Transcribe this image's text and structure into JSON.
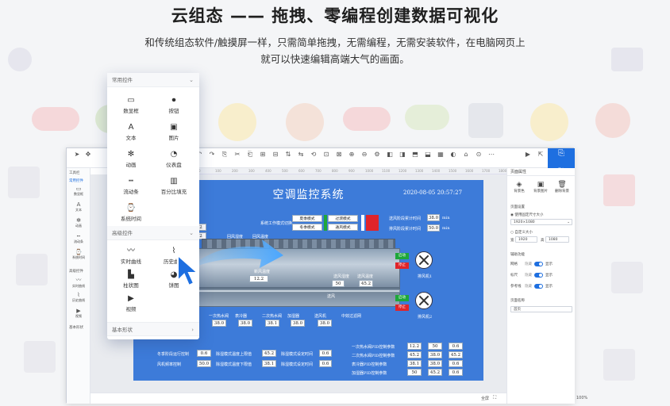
{
  "hero": {
    "title": "云组态 —— 拖拽、零编程创建数据可视化",
    "subtitle_line1": "和传统组态软件/触摸屏一样，只需简单拖拽，无需编程，无需安装软件，在电脑网页上",
    "subtitle_line2": "就可以快速编辑高端大气的画面。"
  },
  "component_panel": {
    "section_common": "常用控件",
    "common_items": [
      {
        "label": "数显框",
        "icon": "number-box-icon",
        "glyph": "▭"
      },
      {
        "label": "按钮",
        "icon": "button-icon",
        "glyph": "⏺"
      },
      {
        "label": "文本",
        "icon": "text-icon",
        "glyph": "A"
      },
      {
        "label": "图片",
        "icon": "image-icon",
        "glyph": "▣"
      },
      {
        "label": "动画",
        "icon": "animation-icon",
        "glyph": "✻"
      },
      {
        "label": "仪表盘",
        "icon": "gauge-icon",
        "glyph": "◔"
      },
      {
        "label": "流动条",
        "icon": "flow-bar-icon",
        "glyph": "┅"
      },
      {
        "label": "百分比填充",
        "icon": "percent-fill-icon",
        "glyph": "▥"
      },
      {
        "label": "系统时间",
        "icon": "clock-icon",
        "glyph": "⌚"
      }
    ],
    "section_advanced": "高级控件",
    "advanced_items": [
      {
        "label": "实时曲线",
        "icon": "realtime-curve-icon",
        "glyph": "〰"
      },
      {
        "label": "历史曲线",
        "icon": "history-curve-icon",
        "glyph": "⌇"
      },
      {
        "label": "柱状图",
        "icon": "bar-chart-icon",
        "glyph": "▙"
      },
      {
        "label": "饼图",
        "icon": "pie-chart-icon",
        "glyph": "◕"
      },
      {
        "label": "视频",
        "icon": "video-icon",
        "glyph": "▶"
      }
    ],
    "section_basic": "基本形状"
  },
  "editor": {
    "left_bar": {
      "head1": "工具栏",
      "head2": "常用控件",
      "items": [
        "数显框",
        "文本",
        "动画",
        "流动条",
        "系统时间"
      ],
      "head3": "高级控件",
      "items2": [
        "实时曲线",
        "历史曲线",
        "视频"
      ],
      "head4": "基本形状"
    },
    "ruler_ticks": [
      "0",
      "100",
      "200",
      "300",
      "400",
      "500",
      "600",
      "700",
      "800",
      "900",
      "1000",
      "1100",
      "1200",
      "1300",
      "1400",
      "1500",
      "1600",
      "1700",
      "1800"
    ],
    "status": {
      "fullscreen": "全屏",
      "zoom": "100%"
    },
    "save_label": "保存",
    "right_panel": {
      "tab": "页面属性",
      "icons": [
        {
          "label": "背景色",
          "glyph": "◈"
        },
        {
          "label": "背景图片",
          "glyph": "▣"
        },
        {
          "label": "删除背景",
          "glyph": "🗑"
        }
      ],
      "page_settings": "页面设置",
      "fixed_size": "使用固定尺寸大小",
      "size_value": "1920×1080",
      "custom_size": "自定义大小",
      "width_label": "宽",
      "width_value": "1920",
      "height_label": "高",
      "height_value": "1080",
      "assist": "辅助功能",
      "opt1": "网格",
      "opt1_state": "隐藏",
      "opt1_on": "显示",
      "opt2": "标尺",
      "opt3": "参考线",
      "page_name_label": "页面名称",
      "page_name_value": "首页"
    }
  },
  "scada": {
    "title": "空调监控系统",
    "datetime": "2020-08-05 20:57:27",
    "mode_label": "系统工作模式切换",
    "modes": [
      "夏季模式",
      "冬季模式",
      "过渡模式",
      "通风模式"
    ],
    "fan1_time_label": "送风阶段累计时间",
    "fan1_time": "38.0",
    "fan2_time_label": "排风阶段累计时间",
    "fan2_time": "50.0",
    "unit_min": "min",
    "return_hum_label": "回风湿度",
    "return_temp_label": "回风温度",
    "fresh_temp_label": "新风温度",
    "fresh_temp": "12.2",
    "supply_hum_label": "送风湿度",
    "supply_hum": "50",
    "supply_temp_label": "送风温度",
    "supply_temp": "45.2",
    "supply_fan_label": "送风",
    "left_val1": "2",
    "left_val2": "2",
    "start": "启动",
    "stop": "停止",
    "fan1": "排风机1",
    "fan2": "排风机2",
    "row_labels": [
      "一次热水阀",
      "表冷器",
      "二次热水阀",
      "加湿器",
      "送风机",
      "中效过滤网"
    ],
    "row_values": [
      "38.0",
      "38.0",
      "38.1",
      "38.0",
      "38.0"
    ],
    "bottom_left": [
      {
        "label": "冬季阶段运行控制",
        "value": "0.6"
      },
      {
        "label": "风机频率控制",
        "value": "50.0"
      }
    ],
    "bottom_mid": [
      {
        "label": "除湿模式温度上限值",
        "value": "45.2"
      },
      {
        "label": "除湿模式温度下限值",
        "value": "38.1"
      }
    ],
    "bottom_mid2": [
      {
        "label": "除湿模式设定时间",
        "value": "0.6"
      },
      {
        "label": "除湿模式设定时间",
        "value": "0.6"
      }
    ],
    "pid_rows": [
      {
        "label": "一次热水阀PID控制参数",
        "vals": [
          "12.2",
          "50",
          "0.6"
        ]
      },
      {
        "label": "二次热水阀PID控制参数",
        "vals": [
          "45.2",
          "38.0",
          "45.2"
        ]
      },
      {
        "label": "表冷器PID控制参数",
        "vals": [
          "38.1",
          "38.0",
          "0.6"
        ]
      },
      {
        "label": "加湿器PID控制参数",
        "vals": [
          "50",
          "45.2",
          "0.6"
        ]
      }
    ]
  },
  "colors": {
    "accent": "#1e6fe0",
    "scada_bg": "#3d7bd9",
    "green": "#1ea73a",
    "red": "#e0242a"
  }
}
